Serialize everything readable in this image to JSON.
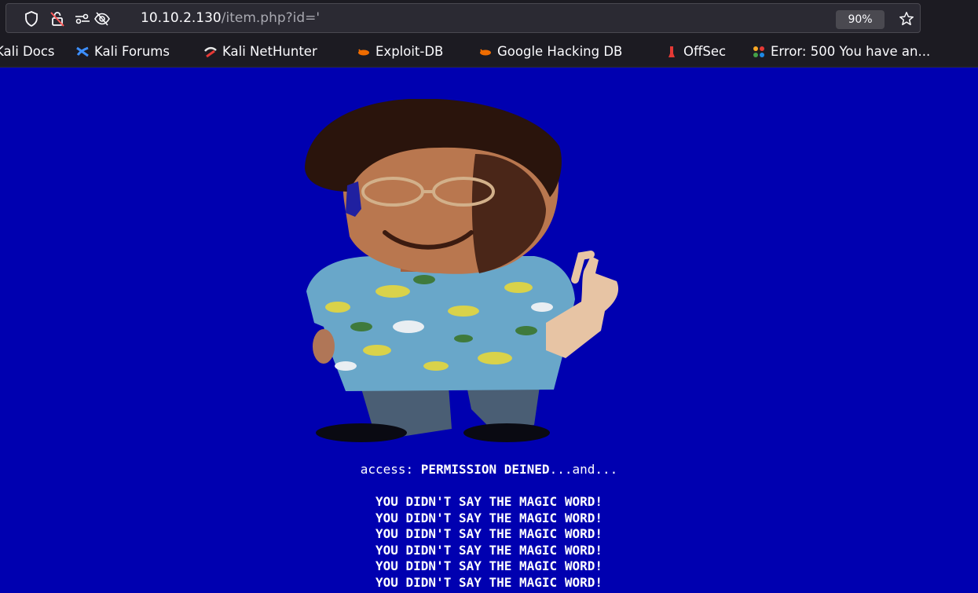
{
  "browser": {
    "url_host": "10.10.2.130",
    "url_path": "/item.php?id='",
    "zoom": "90%",
    "icons": [
      "shield-icon",
      "insecure-lock-icon",
      "permissions-icon",
      "tracking-off-icon",
      "bookmark-star-icon"
    ]
  },
  "bookmarks": [
    {
      "label": "Kali Docs",
      "icon": "kali-docs-icon"
    },
    {
      "label": "Kali Forums",
      "icon": "kali-forums-icon"
    },
    {
      "label": "Kali NetHunter",
      "icon": "kali-nethunter-icon"
    },
    {
      "label": "Exploit-DB",
      "icon": "exploit-db-icon"
    },
    {
      "label": "Google Hacking DB",
      "icon": "ghdb-icon"
    },
    {
      "label": "OffSec",
      "icon": "offsec-icon"
    },
    {
      "label": "Error: 500 You have an...",
      "icon": "joomla-icon"
    }
  ],
  "page": {
    "background": "#0000b0",
    "access_prefix": "access: ",
    "access_status": "PERMISSION DEINED",
    "access_suffix": "...and...",
    "magic_lines": [
      "YOU DIDN'T SAY THE MAGIC WORD!",
      "YOU DIDN'T SAY THE MAGIC WORD!",
      "YOU DIDN'T SAY THE MAGIC WORD!",
      "YOU DIDN'T SAY THE MAGIC WORD!",
      "YOU DIDN'T SAY THE MAGIC WORD!",
      "YOU DIDN'T SAY THE MAGIC WORD!"
    ]
  }
}
